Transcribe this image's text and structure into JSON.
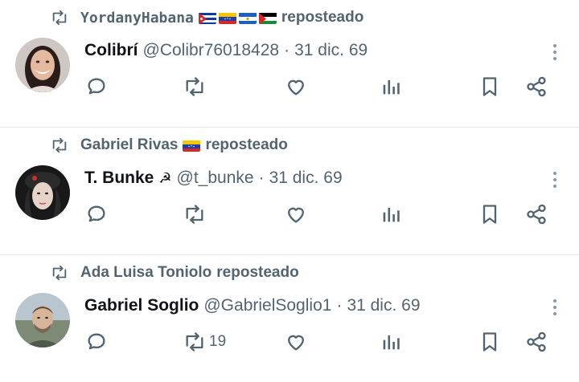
{
  "posts": [
    {
      "reposted_by": "YordanyHabana",
      "reposted_by_flags": [
        "cuba-flag",
        "venezuela-flag",
        "nicaragua-flag",
        "palestine-flag"
      ],
      "reposted_suffix": "reposteado",
      "author_name": "Colibrí",
      "author_emoji": "",
      "handle": "@Colibr76018428",
      "separator": "·",
      "date": "31 dic. 69",
      "retweet_count": ""
    },
    {
      "reposted_by": "Gabriel Rivas",
      "reposted_by_flags": [
        "venezuela-flag"
      ],
      "reposted_suffix": "reposteado",
      "author_name": "T. Bunke",
      "author_emoji": "☭",
      "handle": "@t_bunke",
      "separator": "·",
      "date": "31 dic. 69",
      "retweet_count": ""
    },
    {
      "reposted_by": "Ada Luisa Toniolo",
      "reposted_by_flags": [],
      "reposted_suffix": "reposteado",
      "author_name": "Gabriel Soglio",
      "author_emoji": "",
      "handle": "@GabrielSoglio1",
      "separator": "·",
      "date": "31 dic. 69",
      "retweet_count": "19"
    }
  ],
  "icons": {
    "repost": "repost-icon",
    "reply": "reply-icon",
    "like": "heart-icon",
    "views": "views-icon",
    "bookmark": "bookmark-icon",
    "share": "share-icon",
    "more": "more-vertical-icon"
  },
  "colors": {
    "text": "#0f1419",
    "muted": "#536471",
    "divider": "#e6e9ec"
  }
}
